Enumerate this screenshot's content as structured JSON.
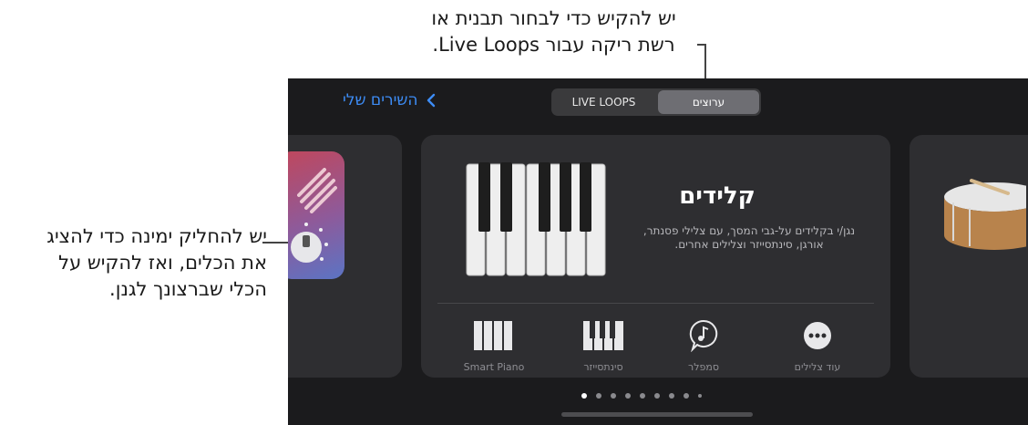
{
  "callouts": {
    "top_line1": "יש להקיש כדי לבחור תבנית או",
    "top_line2": "רשת ריקה עבור Live Loops.",
    "left_line1": "יש להחליק ימינה כדי להציג",
    "left_line2": "את הכלים, ואז להקיש על",
    "left_line3": "הכלי שברצונך לגנן."
  },
  "nav": {
    "back_label": "השירים שלי",
    "segments": [
      {
        "label": "LIVE LOOPS",
        "active": false
      },
      {
        "label": "ערוצים",
        "active": true
      }
    ]
  },
  "instrument": {
    "title": "קלידים",
    "description_line1": "נגן/י בקלידים על-גבי המסך, עם צלילי פסנתר,",
    "description_line2": "אורגן, סינתסייזר וצלילים אחרים."
  },
  "options": [
    {
      "label": "Smart Piano",
      "icon": "smart-piano-icon"
    },
    {
      "label": "סינתסייזר",
      "icon": "synth-keys-icon"
    },
    {
      "label": "סמפלר",
      "icon": "sampler-note-icon"
    },
    {
      "label": "עוד צלילים",
      "icon": "more-ellipsis-icon"
    }
  ],
  "pagination": {
    "count": 9,
    "active_index": 0
  },
  "colors": {
    "accent": "#3d8cf5",
    "background": "#1b1b1d",
    "card": "#2e2e31"
  }
}
